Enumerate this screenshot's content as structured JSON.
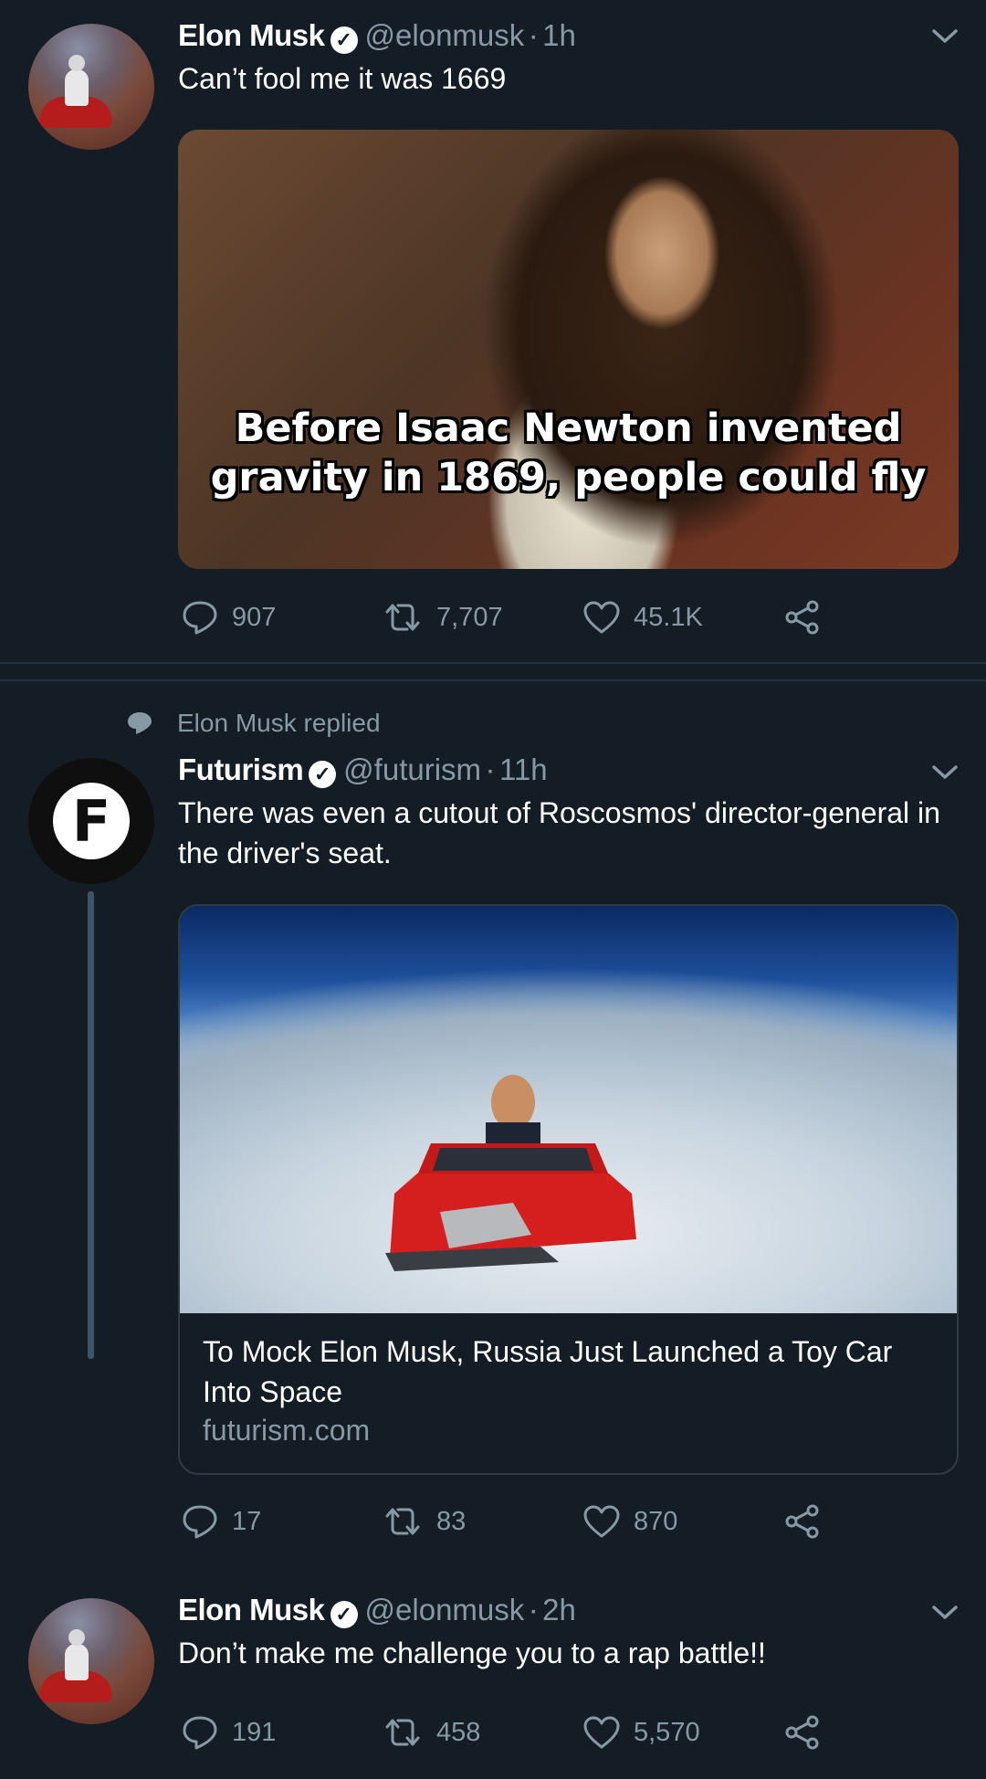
{
  "tweets": [
    {
      "name": "Elon Musk",
      "handle": "@elonmusk",
      "time": "1h",
      "text": "Can’t fool me it was 1669",
      "meme_line1": "Before Isaac Newton invented",
      "meme_line2": "gravity in 1869, people could fly",
      "replies": "907",
      "retweets": "7,707",
      "likes": "45.1K"
    },
    {
      "context": "Elon Musk replied",
      "name": "Futurism",
      "handle": "@futurism",
      "time": "11h",
      "text": "There was even a cutout of Roscosmos' director-general in the driver's seat.",
      "card_title": "To Mock Elon Musk, Russia Just Launched a Toy Car Into Space",
      "card_url": "futurism.com",
      "replies": "17",
      "retweets": "83",
      "likes": "870"
    },
    {
      "name": "Elon Musk",
      "handle": "@elonmusk",
      "time": "2h",
      "text": "Don’t make me challenge you to a rap battle!!",
      "replies": "191",
      "retweets": "458",
      "likes": "5,570"
    }
  ],
  "separator": "·",
  "icons": {
    "verified": "verified-badge-icon",
    "reply": "reply-icon",
    "retweet": "retweet-icon",
    "like": "heart-icon",
    "share": "share-icon",
    "menu": "chevron-down-icon",
    "context": "speech-bubble-icon"
  },
  "colors": {
    "background": "#141d26",
    "secondary_text": "#8899a6",
    "divider": "#243240"
  }
}
